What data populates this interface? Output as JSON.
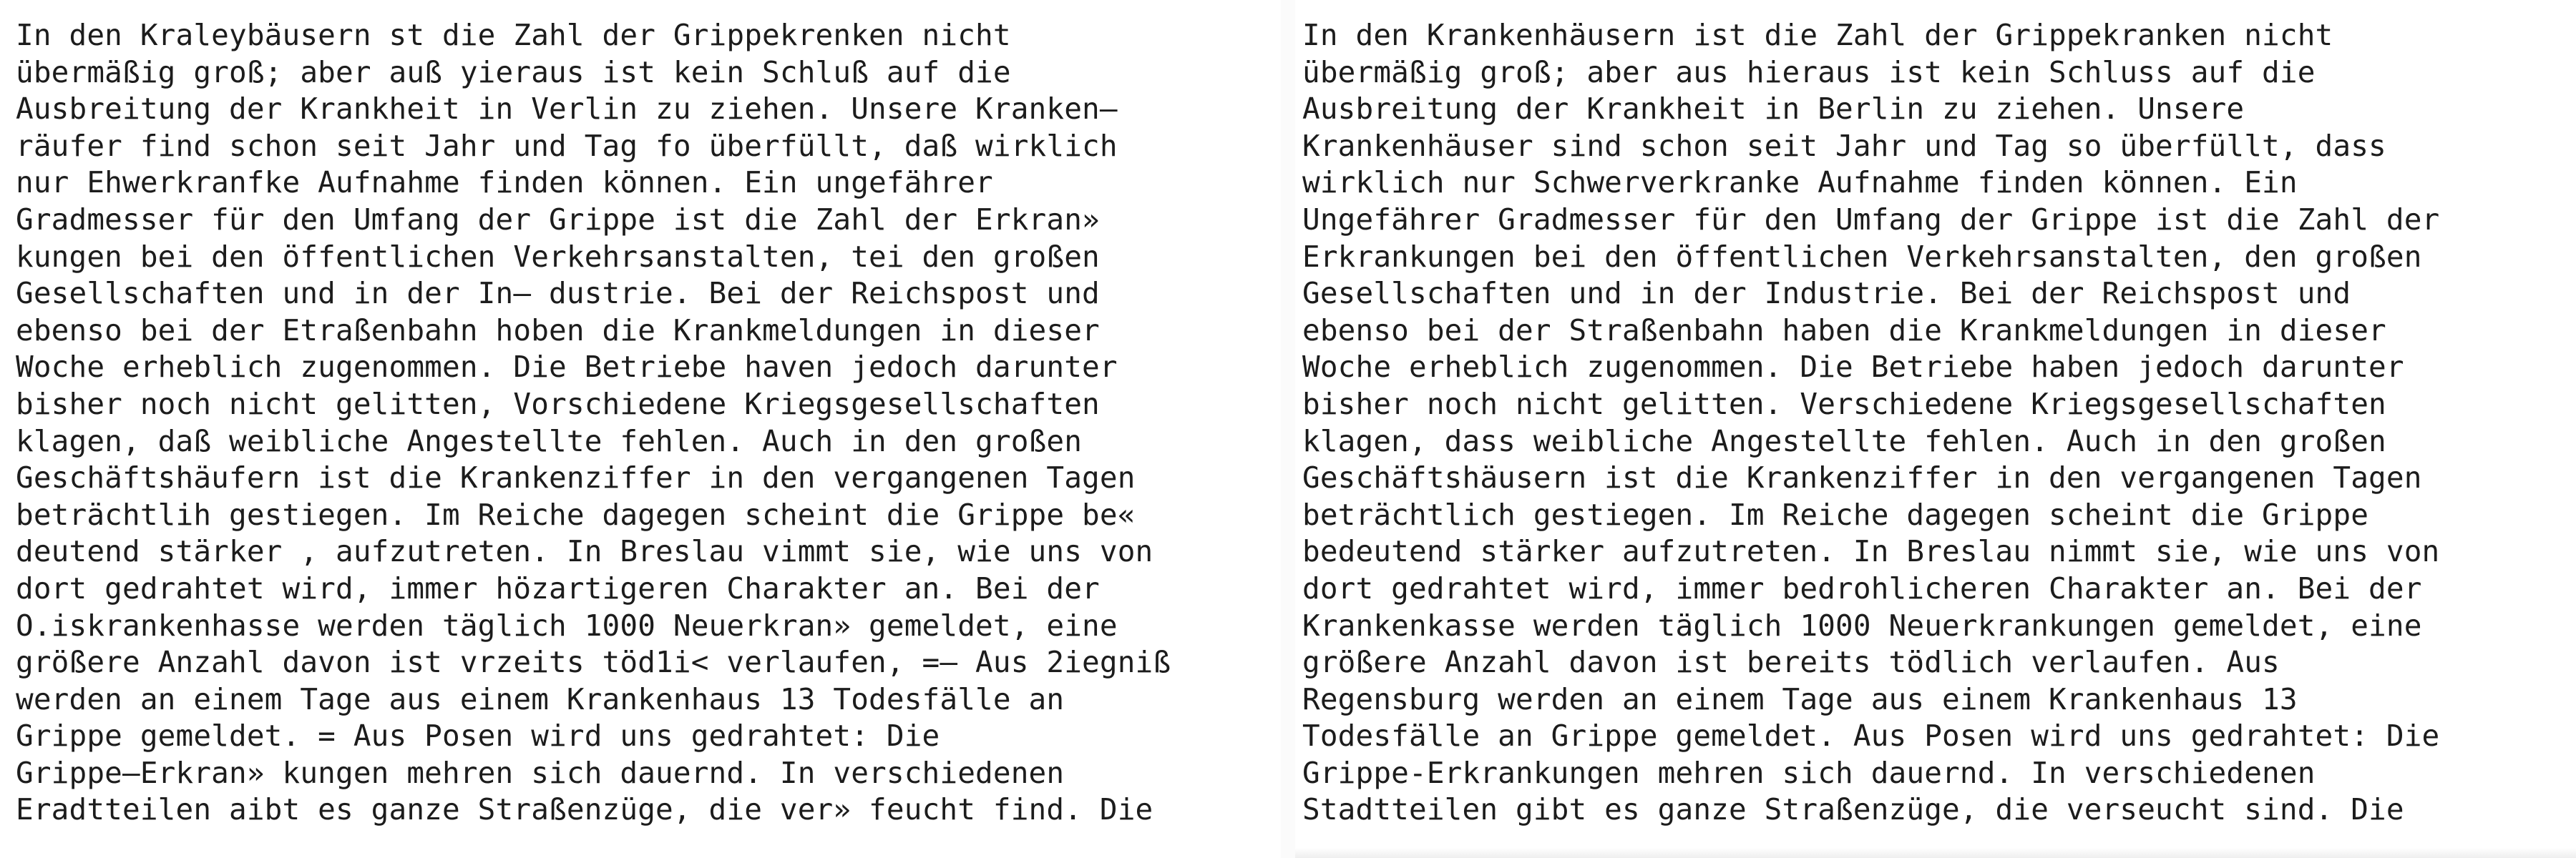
{
  "left_panel": {
    "lines": [
      "In den Kraleybäusern st die Zahl der Grippekrenken nicht",
      "übermäßig groß; aber auß yieraus ist kein Schluß auf die",
      "Ausbreitung der Krankheit in Verlin zu ziehen. Unsere Kranken—",
      "räufer find schon seit Jahr und Tag fo überfüllt, daß wirklich",
      "nur Ehwerkranfke Aufnahme finden können. Ein ungefährer",
      "Gradmesser für den Umfang der Grippe ist die Zahl der Erkran»",
      "kungen bei den öffentlichen Verkehrsanstalten, tei den großen",
      "Gesellschaften und in der In— dustrie. Bei der Reichspost und",
      "ebenso bei der Etraßenbahn hoben die Krankmeldungen in dieser",
      "Woche erheblich zugenommen. Die Betriebe haven jedoch darunter",
      "bisher noch nicht gelitten, Vorschiedene Kriegsgesellschaften",
      "klagen, daß weibliche Angestellte fehlen. Auch in den großen",
      "Geschäftshäufern ist die Krankenziffer in den vergangenen Tagen",
      "beträchtlih gestiegen. Im Reiche dagegen scheint die Grippe be«",
      "deutend stärker , aufzutreten. In Breslau vimmt sie, wie uns von",
      "dort gedrahtet wird, immer hözartigeren Charakter an. Bei der",
      "O.iskrankenhasse werden täglich 1000 Neuerkran» gemeldet, eine",
      "größere Anzahl davon ist vrzeits töd1i< verlaufen, =— Aus 2iegniß",
      "werden an einem Tage aus einem Krankenhaus 13 Todesfälle an",
      "Grippe gemeldet. = Aus Posen wird uns gedrahtet: Die",
      "Grippe—Erkran» kungen mehren sich dauernd. In verschiedenen",
      "Eradtteilen aibt es ganze Straßenzüge, die ver» feucht find. Die"
    ]
  },
  "right_panel": {
    "lines": [
      "In den Krankenhäusern ist die Zahl der Grippekranken nicht",
      "übermäßig groß; aber aus hieraus ist kein Schluss auf die",
      "Ausbreitung der Krankheit in Berlin zu ziehen. Unsere",
      "Krankenhäuser sind schon seit Jahr und Tag so überfüllt, dass",
      "wirklich nur Schwerverkranke Aufnahme finden können. Ein",
      "Ungefährer Gradmesser für den Umfang der Grippe ist die Zahl der",
      "Erkrankungen bei den öffentlichen Verkehrsanstalten, den großen",
      "Gesellschaften und in der Industrie. Bei der Reichspost und",
      "ebenso bei der Straßenbahn haben die Krankmeldungen in dieser",
      "Woche erheblich zugenommen. Die Betriebe haben jedoch darunter",
      "bisher noch nicht gelitten. Verschiedene Kriegsgesellschaften",
      "klagen, dass weibliche Angestellte fehlen. Auch in den großen",
      "Geschäftshäusern ist die Krankenziffer in den vergangenen Tagen",
      "beträchtlich gestiegen. Im Reiche dagegen scheint die Grippe",
      "bedeutend stärker aufzutreten. In Breslau nimmt sie, wie uns von",
      "dort gedrahtet wird, immer bedrohlicheren Charakter an. Bei der",
      "Krankenkasse werden täglich 1000 Neuerkrankungen gemeldet, eine",
      "größere Anzahl davon ist bereits tödlich verlaufen. Aus",
      "Regensburg werden an einem Tage aus einem Krankenhaus 13",
      "Todesfälle an Grippe gemeldet. Aus Posen wird uns gedrahtet: Die",
      "Grippe-Erkrankungen mehren sich dauernd. In verschiedenen",
      "Stadtteilen gibt es ganze Straßenzüge, die verseucht sind. Die"
    ]
  }
}
